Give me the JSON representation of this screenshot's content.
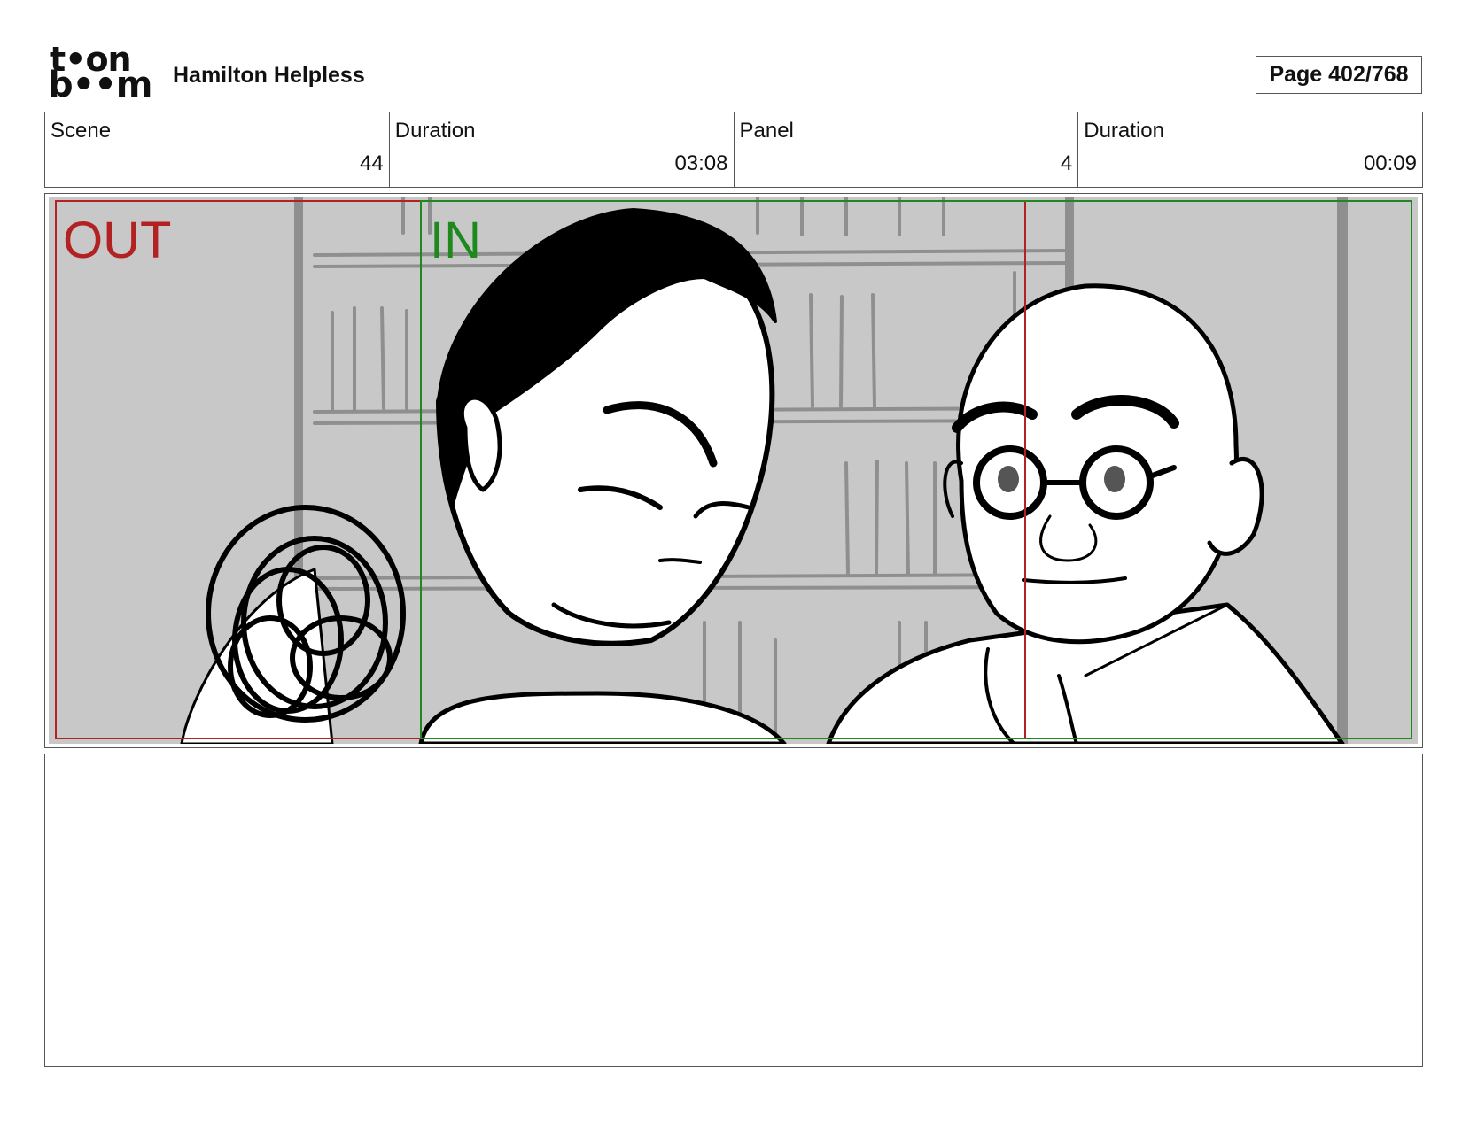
{
  "header": {
    "logo": {
      "line1": "t•on",
      "line2": "b••m"
    },
    "project_title": "Hamilton Helpless",
    "page_label": "Page 402/768"
  },
  "info": {
    "scene_label": "Scene",
    "scene_value": "44",
    "scene_duration_label": "Duration",
    "scene_duration_value": "03:08",
    "panel_label": "Panel",
    "panel_value": "4",
    "panel_duration_label": "Duration",
    "panel_duration_value": "00:09"
  },
  "panel": {
    "out_label": "OUT",
    "in_label": "IN",
    "colors": {
      "out_frame": "#b22222",
      "in_frame": "#1e8a1e",
      "background": "#c8c8c8"
    }
  },
  "caption": {
    "text": ""
  }
}
